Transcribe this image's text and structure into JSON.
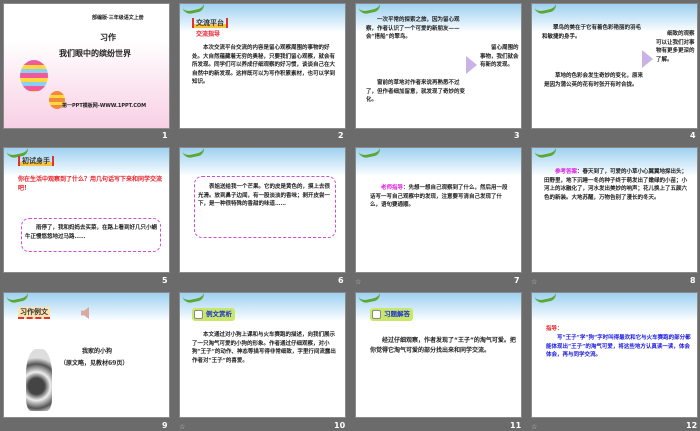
{
  "slides": [
    {
      "number": "1",
      "publisher": "部编版·三年级语文上册",
      "title": "习作",
      "subtitle": "我们眼中的缤纷世界",
      "watermark": "第一PPT模板网-WWW.1PPT.COM"
    },
    {
      "number": "2",
      "tag": "交流平台",
      "subtag": "交流指导",
      "body": "本次交流平台交流的内容是留心观察周围的事物的好处。大自然蕴藏着无穷的奥秘，只要我们留心观察，就会有所发现。同学们可以养成仔细观察的好习惯，谈谈自己在大自然中的新发现。这样既可以为写作积累素材，也可以学到知识。"
    },
    {
      "number": "3",
      "p1": "一次平常的探索之旅，因为留心观察，作者认识了一个可爱的新朋友——会“搭船”的翠鸟。",
      "p2": "窗前的草地对作者来说再熟悉不过了，但作者细加留意，就发现了奇妙的变化。",
      "side": "留心周围的事物，我们就会有新的发现。"
    },
    {
      "number": "4",
      "p1": "翠鸟的美在于它有着色彩艳丽的羽毛和敏捷的身手。",
      "p2": "草地的色彩会发生奇妙的变化，原来是因为蒲公英的花有时张开有时合拢。",
      "side": "细致的观察可以让我们对事物有更多更深的了解。"
    },
    {
      "number": "5",
      "tag": "初试身手",
      "prompt": "你在生活中观察到了什么？用几句话写下来和同学交流吧！",
      "example": "雨停了，我和妈妈去买菜，在路上看到好几只小蜗牛正慢悠悠地过马路……"
    },
    {
      "number": "6",
      "example": "表姐送给我一个芒果。它的皮是黄色的，摸上去很光滑。放到鼻子边闻，有一股淡淡的香味；剥开皮尝一下，是一种很特殊的香甜的味道……"
    },
    {
      "number": "7",
      "label": "老师指导",
      "body": "：先想一想自己观察到了什么，然后用一段话写一写自己观察中的发现，注意要写清自己发现了什么，语句要通顺。"
    },
    {
      "number": "8",
      "label": "参考答案",
      "body": "：春天到了，可爱的小草小心翼翼地探出头；田野里，地下沉睡一冬的种子终于萌发出了嫩绿的小苗；小河上的冰融化了，河水发出美妙的响声；花儿换上了五颜六色的新装。大地苏醒，万物告别了漫长的冬天。"
    },
    {
      "number": "9",
      "tag": "习作例文",
      "title": "我家的小狗",
      "note": "（原文略，见教材69页）"
    },
    {
      "number": "10",
      "tag": "例文赏析",
      "body": "本文通过对小狗上课和与火车赛跑的描述，向我们展示了一只淘气可爱的小狗的形象。作者通过仔细观察，对小狗“王子”的动作、神态等描写得非常细致，字里行间流露出作者对“王子”的喜爱。"
    },
    {
      "number": "11",
      "tag": "习题解答",
      "body": "经过仔细观察，作者发现了“王子”的淘气可爱。把你觉得它淘气可爱的部分找出来和同学交流。"
    },
    {
      "number": "12",
      "label": "指导：",
      "body": "写“王子”学“狗”字时叫得最欢和它与火车赛跑的部分都能体现出“王子”的淘气可爱，将这些地方认真读一读，体会体会，再与同学交流。"
    }
  ],
  "colors": {
    "background": "#6b6b6b",
    "accent_red": "#e8202a",
    "accent_pink": "#e020e0",
    "accent_blue": "#1a1ae0"
  }
}
